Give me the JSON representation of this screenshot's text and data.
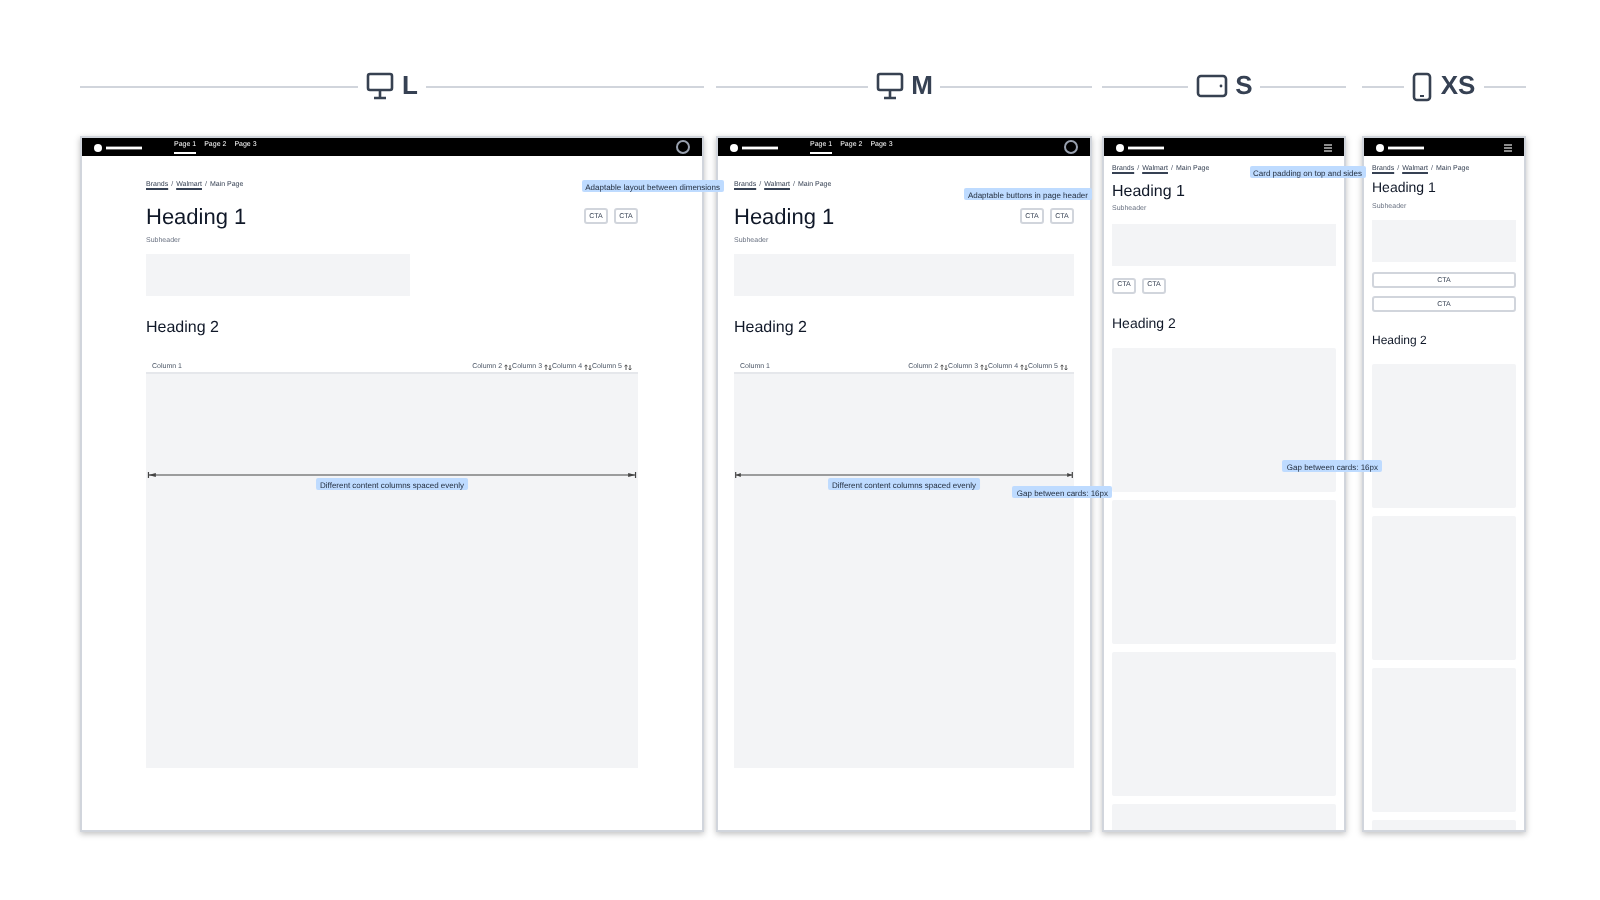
{
  "breakpoints": [
    {
      "label": "L",
      "kind": "desktop-l",
      "nav": {
        "kind": "links",
        "links": [
          {
            "label": "Page 1",
            "selected": true
          },
          {
            "label": "Page 2",
            "selected": false
          },
          {
            "label": "Page 3",
            "selected": false
          }
        ]
      },
      "breadcrumbs": [
        "Brands",
        "Walmart",
        "Main Page"
      ],
      "breadcrumb_separators": [
        "/",
        "/"
      ],
      "heading1": "Heading 1",
      "subheader": "Subheader",
      "ctas": [
        "CTA",
        "CTA"
      ],
      "heading2": "Heading 2",
      "content": {
        "kind": "table",
        "columns": [
          {
            "label": "Column 1",
            "sortable": false
          },
          {
            "label": "Column 2",
            "sortable": true
          },
          {
            "label": "Column 3",
            "sortable": true
          },
          {
            "label": "Column 4",
            "sortable": true
          },
          {
            "label": "Column 5",
            "sortable": true
          }
        ]
      },
      "annotations": [
        {
          "text": "Adaptable layout between dimensions",
          "kind": "breadcrumb-edge"
        },
        {
          "text": "Different content columns spaced evenly",
          "kind": "table-center"
        }
      ]
    },
    {
      "label": "M",
      "kind": "desktop-m",
      "nav": {
        "kind": "links",
        "links": [
          {
            "label": "Page 1",
            "selected": true
          },
          {
            "label": "Page 2",
            "selected": false
          },
          {
            "label": "Page 3",
            "selected": false
          }
        ]
      },
      "breadcrumbs": [
        "Brands",
        "Walmart",
        "Main Page"
      ],
      "breadcrumb_separators": [
        "/",
        "/"
      ],
      "heading1": "Heading 1",
      "subheader": "Subheader",
      "ctas": [
        "CTA",
        "CTA"
      ],
      "heading2": "Heading 2",
      "content": {
        "kind": "table",
        "columns": [
          {
            "label": "Column 1",
            "sortable": false
          },
          {
            "label": "Column 2",
            "sortable": true
          },
          {
            "label": "Column 3",
            "sortable": true
          },
          {
            "label": "Column 4",
            "sortable": true
          },
          {
            "label": "Column 5",
            "sortable": true
          }
        ]
      },
      "annotations": [
        {
          "text": "Adaptable buttons in page header",
          "kind": "above-cta"
        },
        {
          "text": "Different content columns spaced evenly",
          "kind": "table-center"
        },
        {
          "text": "Gap between cards: 16px",
          "kind": "edge-right"
        }
      ]
    },
    {
      "label": "S",
      "kind": "tablet",
      "nav": {
        "kind": "menu"
      },
      "breadcrumbs": [
        "Brands",
        "Walmart",
        "Main Page"
      ],
      "breadcrumb_separators": [
        "/",
        "/"
      ],
      "heading1": "Heading 1",
      "subheader": "Subheader",
      "ctas": [
        "CTA",
        "CTA"
      ],
      "heading2": "Heading 2",
      "content": {
        "kind": "cards"
      },
      "annotations": [
        {
          "text": "Card padding on top and sides",
          "kind": "header-edge"
        },
        {
          "text": "Gap between cards: 16px",
          "kind": "card-edge"
        }
      ]
    },
    {
      "label": "XS",
      "kind": "phone",
      "nav": {
        "kind": "menu"
      },
      "breadcrumbs": [
        "Brands",
        "Walmart",
        "Main Page"
      ],
      "breadcrumb_separators": [
        "/",
        "/"
      ],
      "heading1": "Heading 1",
      "subheader": "Subheader",
      "ctas": [
        "CTA",
        "CTA"
      ],
      "heading2": "Heading 2",
      "content": {
        "kind": "cards"
      }
    }
  ]
}
